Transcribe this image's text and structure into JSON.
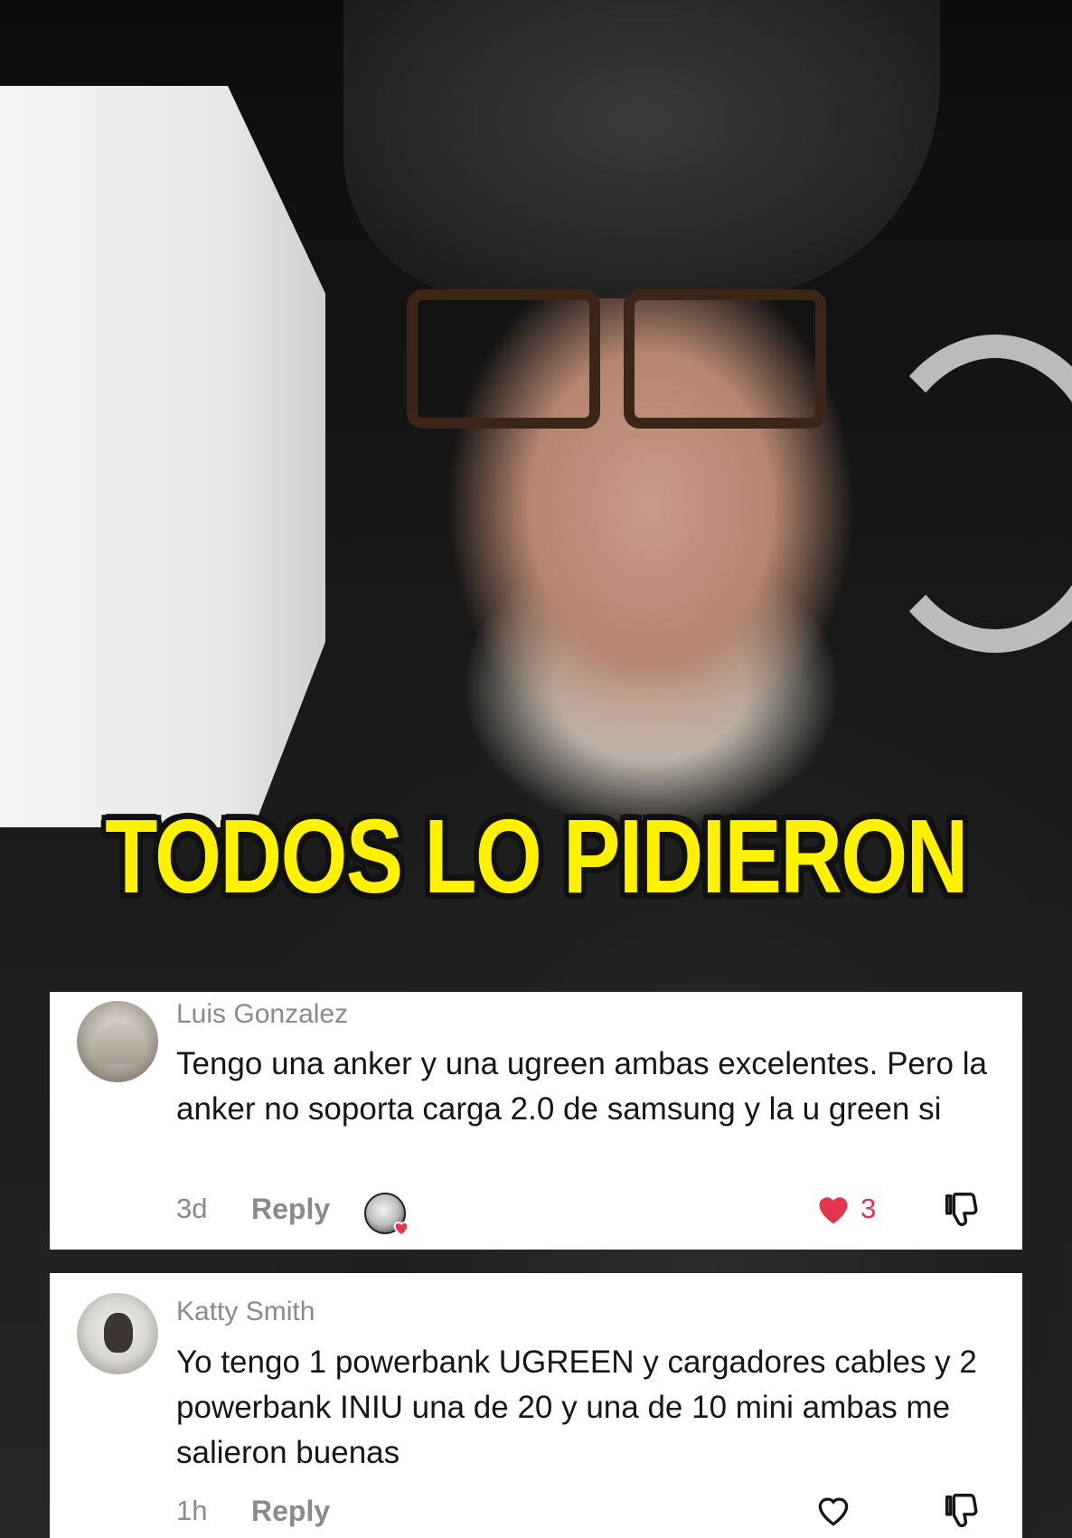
{
  "video": {
    "headline": "TODOS LO PIDIERON"
  },
  "comments": [
    {
      "username": "Luis Gonzalez",
      "text": "Tengo una anker y una ugreen ambas excelentes. Pero la anker no soporta carga 2.0 de samsung y la u green si",
      "time": "3d",
      "reply_label": "Reply",
      "liked_by_creator": true,
      "liked": true,
      "like_count": "3"
    },
    {
      "username": "Katty Smith",
      "text": "Yo tengo 1 powerbank UGREEN y cargadores cables y 2 powerbank INIU una de 20 y una de 10 mini ambas me salieron buenas",
      "time": "1h",
      "reply_label": "Reply",
      "liked_by_creator": false,
      "liked": false,
      "like_count": ""
    }
  ],
  "colors": {
    "headline": "#fff200",
    "like_red": "#e4354f",
    "meta_gray": "#8a8a8a"
  },
  "icons": {
    "like": "heart-icon",
    "dislike": "thumbs-down-icon",
    "creator_like": "creator-heart-badge-icon"
  }
}
